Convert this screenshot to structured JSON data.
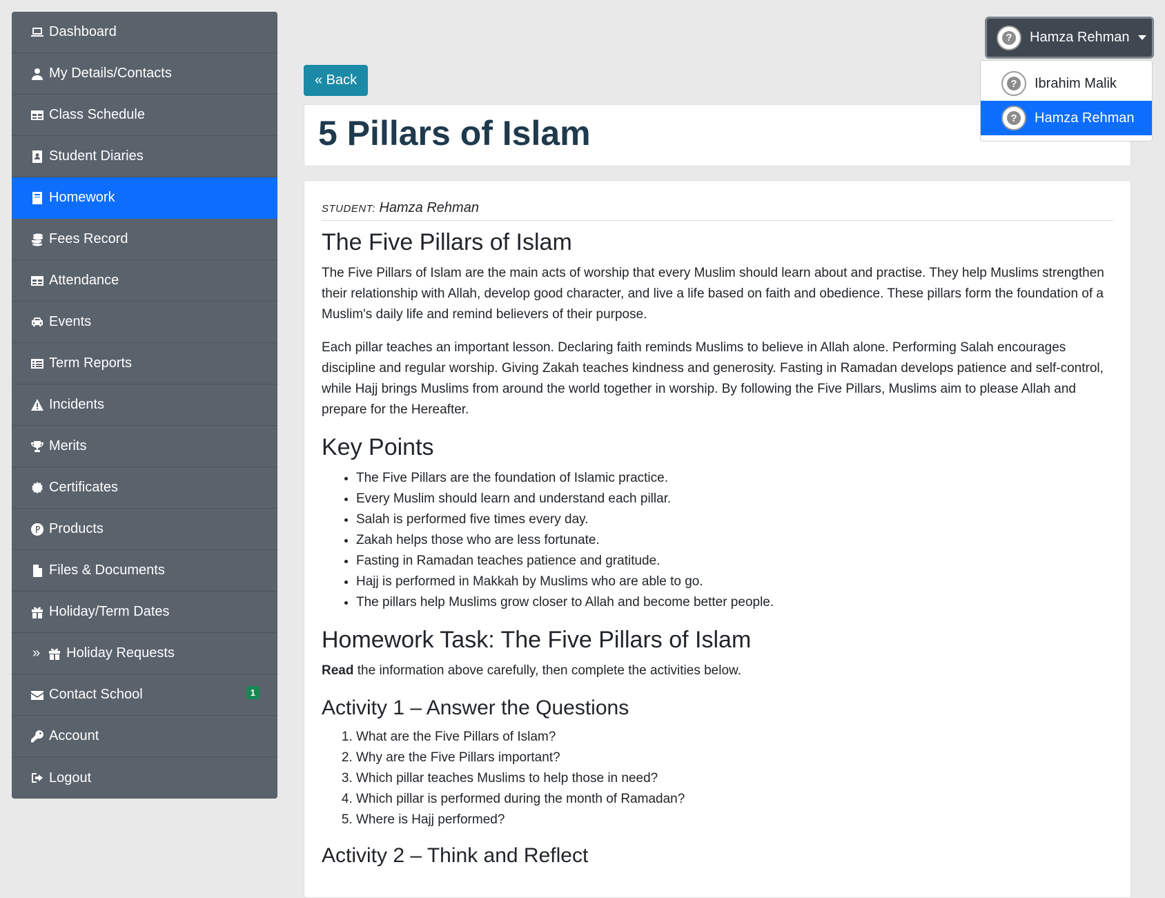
{
  "sidebar": {
    "items": [
      {
        "label": "Dashboard",
        "icon": "laptop-icon"
      },
      {
        "label": "My Details/Contacts",
        "icon": "user-icon"
      },
      {
        "label": "Class Schedule",
        "icon": "table-icon"
      },
      {
        "label": "Student Diaries",
        "icon": "address-book-icon"
      },
      {
        "label": "Homework",
        "icon": "book-icon",
        "active": true
      },
      {
        "label": "Fees Record",
        "icon": "coins-icon"
      },
      {
        "label": "Attendance",
        "icon": "table-icon"
      },
      {
        "label": "Events",
        "icon": "car-icon"
      },
      {
        "label": "Term Reports",
        "icon": "list-icon"
      },
      {
        "label": "Incidents",
        "icon": "warning-icon"
      },
      {
        "label": "Merits",
        "icon": "trophy-icon"
      },
      {
        "label": "Certificates",
        "icon": "certificate-icon"
      },
      {
        "label": "Products",
        "icon": "product-icon"
      },
      {
        "label": "Files & Documents",
        "icon": "file-icon"
      },
      {
        "label": "Holiday/Term Dates",
        "icon": "gift-icon"
      },
      {
        "label": "Holiday Requests",
        "icon": "gift-icon",
        "sub": true
      },
      {
        "label": "Contact School",
        "icon": "envelope-icon",
        "badge": "1"
      },
      {
        "label": "Account",
        "icon": "key-icon"
      },
      {
        "label": "Logout",
        "icon": "logout-icon"
      }
    ]
  },
  "back_label": "« Back",
  "page_title": "5 Pillars of Islam",
  "user_menu": {
    "current": "Hamza Rehman",
    "options": [
      "Ibrahim Malik",
      "Hamza Rehman"
    ],
    "avatar_glyph": "?"
  },
  "content": {
    "student_label": "STUDENT:",
    "student_name": "Hamza Rehman",
    "heading1": "The Five Pillars of Islam",
    "para1": "The Five Pillars of Islam are the main acts of worship that every Muslim should learn about and practise. They help Muslims strengthen their relationship with Allah, develop good character, and live a life based on faith and obedience. These pillars form the foundation of a Muslim's daily life and remind believers of their purpose.",
    "para2": "Each pillar teaches an important lesson. Declaring faith reminds Muslims to believe in Allah alone. Performing Salah encourages discipline and regular worship. Giving Zakah teaches kindness and generosity. Fasting in Ramadan develops patience and self-control, while Hajj brings Muslims from around the world together in worship. By following the Five Pillars, Muslims aim to please Allah and prepare for the Hereafter.",
    "heading2": "Key Points",
    "key_points": [
      "The Five Pillars are the foundation of Islamic practice.",
      "Every Muslim should learn and understand each pillar.",
      "Salah is performed five times every day.",
      "Zakah helps those who are less fortunate.",
      "Fasting in Ramadan teaches patience and gratitude.",
      "Hajj is performed in Makkah by Muslims who are able to go.",
      "The pillars help Muslims grow closer to Allah and become better people."
    ],
    "heading3": "Homework Task: The Five Pillars of Islam",
    "task_bold": "Read",
    "task_rest": " the information above carefully, then complete the activities below.",
    "activity1_heading": "Activity 1 – Answer the Questions",
    "questions": [
      "What are the Five Pillars of Islam?",
      "Why are the Five Pillars important?",
      "Which pillar teaches Muslims to help those in need?",
      "Which pillar is performed during the month of Ramadan?",
      "Where is Hajj performed?"
    ],
    "activity2_heading": "Activity 2 – Think and Reflect"
  }
}
